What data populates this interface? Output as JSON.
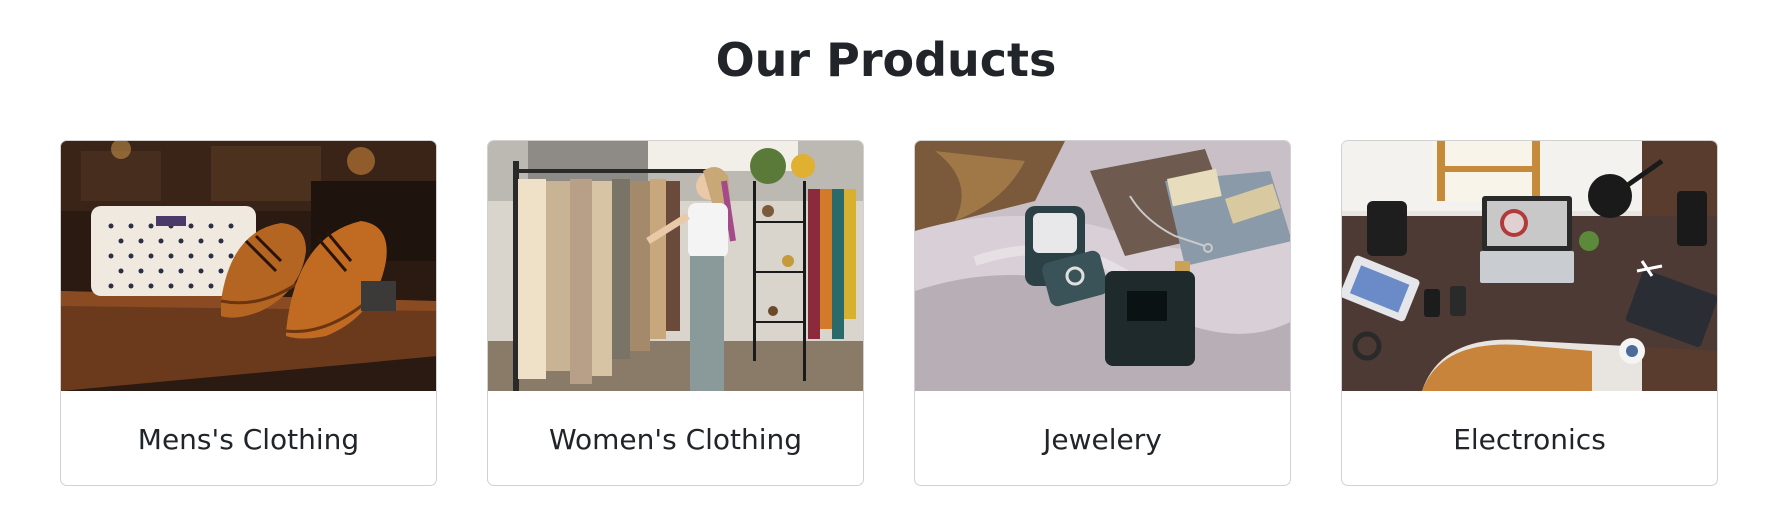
{
  "page": {
    "title": "Our Products"
  },
  "products": [
    {
      "name": "Mens's Clothing",
      "image": "mens-clothing-photo"
    },
    {
      "name": "Women's Clothing",
      "image": "womens-clothing-photo"
    },
    {
      "name": "Jewelery",
      "image": "jewelery-photo"
    },
    {
      "name": "Electronics",
      "image": "electronics-photo"
    }
  ]
}
